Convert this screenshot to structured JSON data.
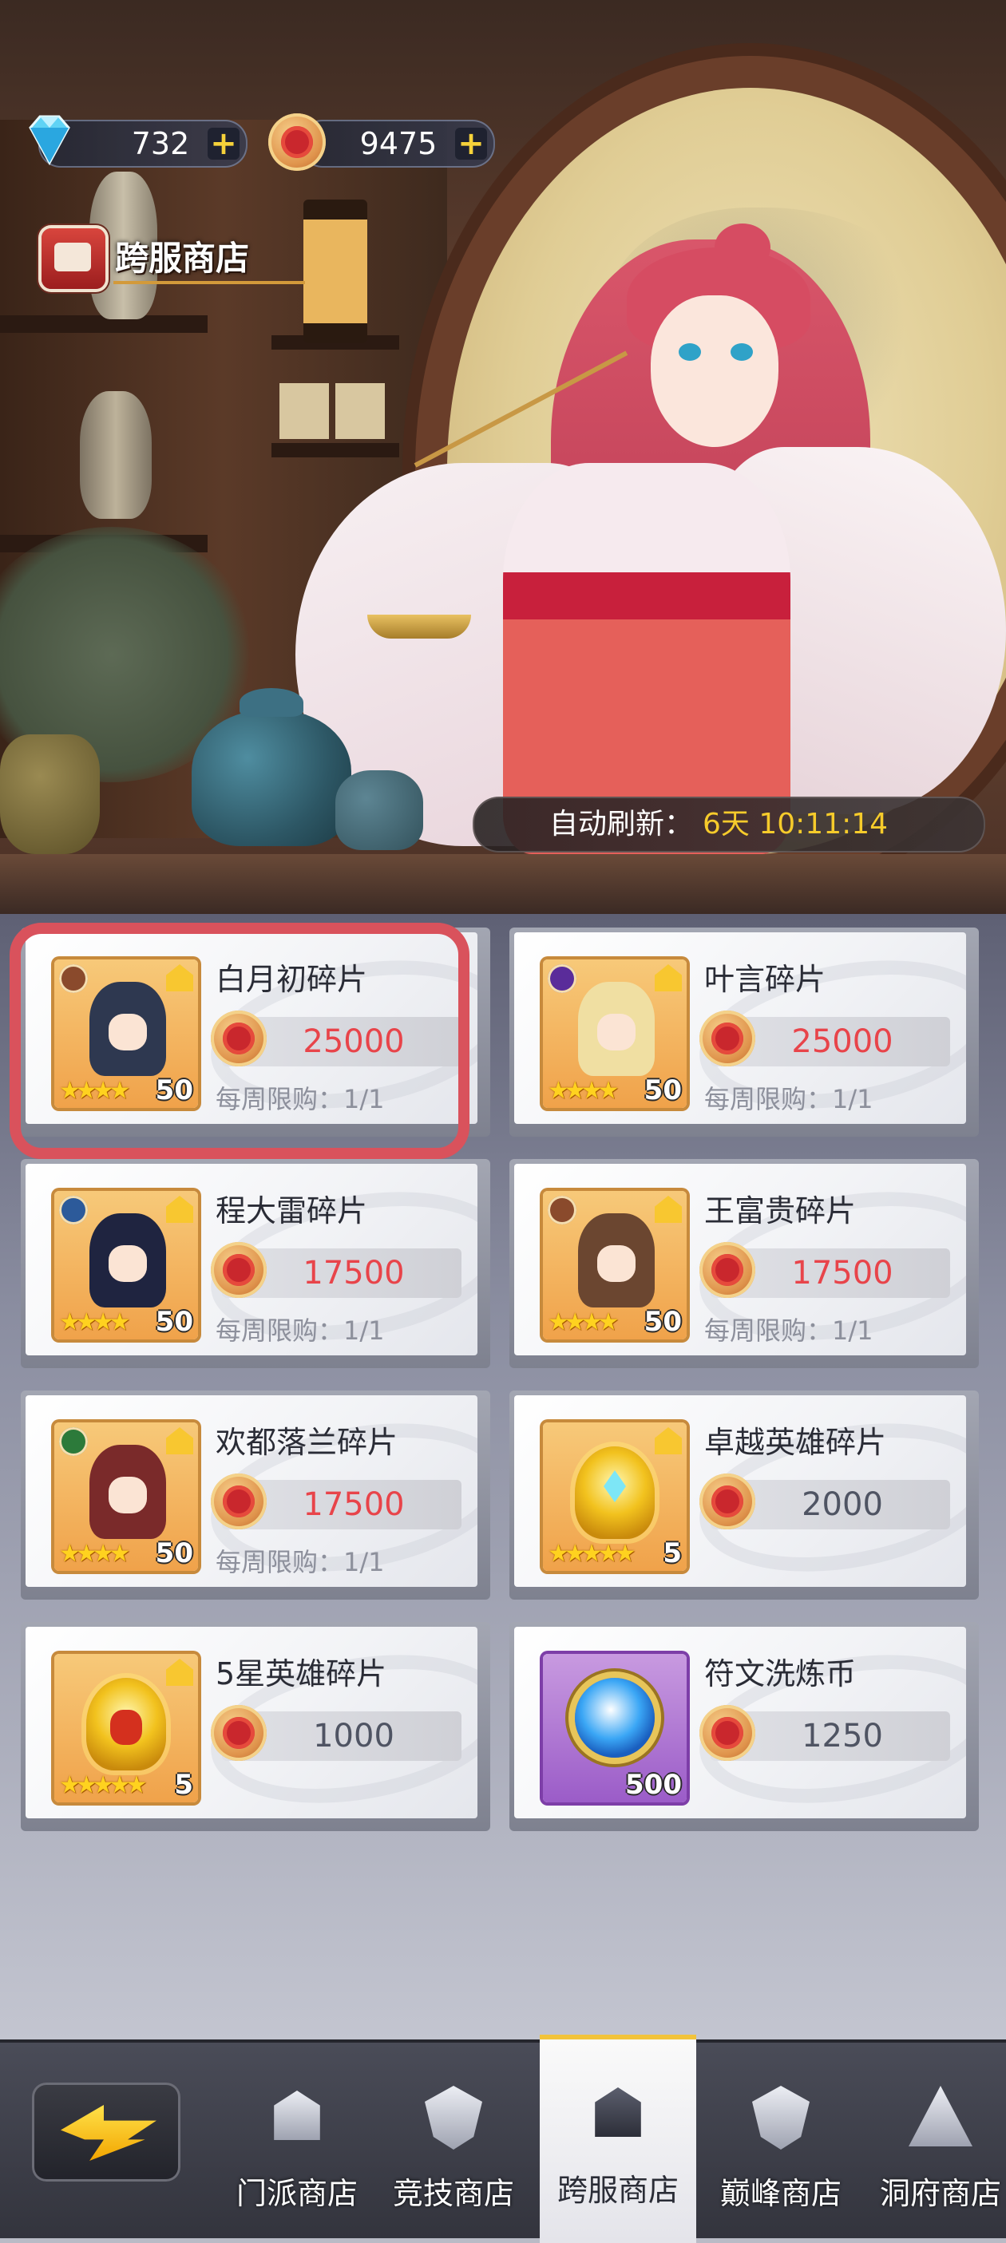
{
  "currencies": {
    "diamonds": "732",
    "coins": "9475"
  },
  "shop_title": "跨服商店",
  "refresh": {
    "label": "自动刷新：",
    "time": "6天 10:11:14"
  },
  "items": [
    {
      "name": "白月初碎片",
      "price": "25000",
      "price_color": "red",
      "limit": "每周限购：1/1",
      "count": "50",
      "stars": "★★★★",
      "faction": "brown",
      "hair": "#2e3850",
      "selected": true
    },
    {
      "name": "叶言碎片",
      "price": "25000",
      "price_color": "red",
      "limit": "每周限购：1/1",
      "count": "50",
      "stars": "★★★★",
      "faction": "purple",
      "hair": "#f0dfa2",
      "selected": false
    },
    {
      "name": "程大雷碎片",
      "price": "17500",
      "price_color": "red",
      "limit": "每周限购：1/1",
      "count": "50",
      "stars": "★★★★",
      "faction": "blue",
      "hair": "#1f2440",
      "selected": false
    },
    {
      "name": "王富贵碎片",
      "price": "17500",
      "price_color": "red",
      "limit": "每周限购：1/1",
      "count": "50",
      "stars": "★★★★",
      "faction": "brown",
      "hair": "#6b4630",
      "selected": false
    },
    {
      "name": "欢都落兰碎片",
      "price": "17500",
      "price_color": "red",
      "limit": "每周限购：1/1",
      "count": "50",
      "stars": "★★★★",
      "faction": "green",
      "hair": "#7a2a2a",
      "selected": false
    },
    {
      "name": "卓越英雄碎片",
      "price": "2000",
      "price_color": "gray",
      "limit": "",
      "count": "5",
      "stars": "★★★★★",
      "icon": "gold-helmet-gem-icon"
    },
    {
      "name": "5星英雄碎片",
      "price": "1000",
      "price_color": "gray",
      "limit": "",
      "count": "5",
      "stars": "★★★★★",
      "icon": "gold-helmet-red-icon"
    },
    {
      "name": "符文洗炼币",
      "price": "1250",
      "price_color": "gray",
      "limit": "",
      "count": "500",
      "stars": "",
      "icon": "rune-coin-icon"
    }
  ],
  "nav": [
    {
      "label": "门派商店",
      "icon": "gate-icon",
      "active": false
    },
    {
      "label": "竞技商店",
      "icon": "shield-icon",
      "active": false
    },
    {
      "label": "跨服商店",
      "icon": "pagoda-icon",
      "active": true
    },
    {
      "label": "巅峰商店",
      "icon": "peak-shield-icon",
      "active": false
    },
    {
      "label": "洞府商店",
      "icon": "mountain-icon",
      "active": false
    }
  ],
  "colors": {
    "price_red": "#e8444a",
    "price_gray": "#4f5463",
    "refresh_time": "#f6cb2b",
    "highlight": "#d9525c",
    "plus": "#f6d23a"
  }
}
